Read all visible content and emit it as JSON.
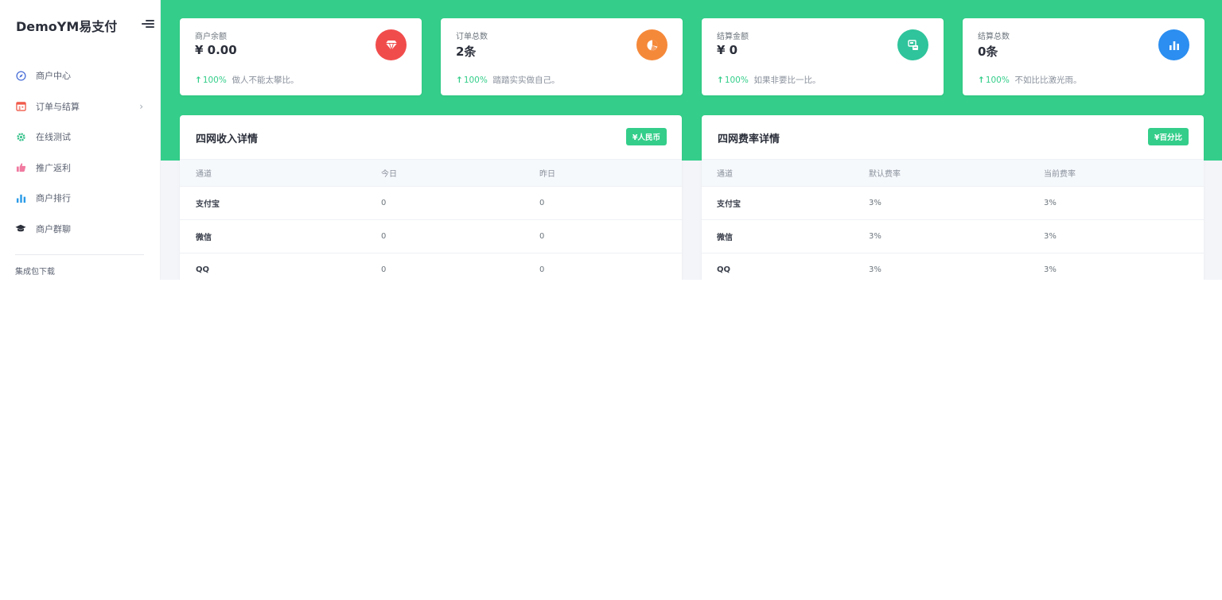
{
  "app": {
    "brand": "DemoYM易支付"
  },
  "sidebar": {
    "items": [
      {
        "label": "商户中心",
        "icon": "compass-icon"
      },
      {
        "label": "订单与结算",
        "icon": "calendar-icon",
        "has_children": true
      },
      {
        "label": "在线测试",
        "icon": "gear-icon"
      },
      {
        "label": "推广返利",
        "icon": "thumbs-up-icon"
      },
      {
        "label": "商户排行",
        "icon": "bar-chart-icon"
      },
      {
        "label": "商户群聊",
        "icon": "graduation-cap-icon"
      }
    ],
    "section_label": "集成包下载"
  },
  "stats": [
    {
      "title": "商户余额",
      "value": "¥ 0.00",
      "percent": "100%",
      "note": "做人不能太攀比。",
      "icon": "diamond-icon",
      "color": "#f14c4c"
    },
    {
      "title": "订单总数",
      "value": "2条",
      "percent": "100%",
      "note": "踏踏实实做自己。",
      "icon": "pie-chart-icon",
      "color": "#f5893a"
    },
    {
      "title": "结算金额",
      "value": "¥ 0",
      "percent": "100%",
      "note": "如果非要比一比。",
      "icon": "cash-register-icon",
      "color": "#2fc49b"
    },
    {
      "title": "结算总数",
      "value": "0条",
      "percent": "100%",
      "note": "不如比比激光雨。",
      "icon": "bar-chart-icon",
      "color": "#2b8ef0"
    }
  ],
  "income_table": {
    "title": "四网收入详情",
    "badge": "¥人民币",
    "columns": [
      "通道",
      "今日",
      "昨日"
    ],
    "rows": [
      [
        "支付宝",
        "0",
        "0"
      ],
      [
        "微信",
        "0",
        "0"
      ],
      [
        "QQ",
        "0",
        "0"
      ]
    ]
  },
  "rate_table": {
    "title": "四网费率详情",
    "badge": "¥百分比",
    "columns": [
      "通道",
      "默认费率",
      "当前费率"
    ],
    "rows": [
      [
        "支付宝",
        "3%",
        "3%"
      ],
      [
        "微信",
        "3%",
        "3%"
      ],
      [
        "QQ",
        "3%",
        "3%"
      ]
    ]
  },
  "colors": {
    "accent": "#34ce8a",
    "background": "#f3f5f9"
  }
}
